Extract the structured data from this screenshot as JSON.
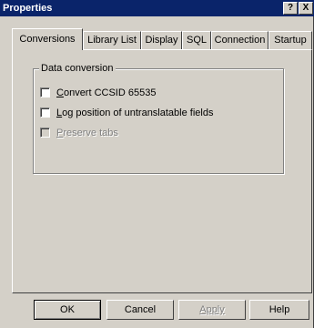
{
  "window": {
    "title": "Properties",
    "help_button": "?",
    "close_button": "X"
  },
  "tabs": [
    {
      "label": "Conversions",
      "selected": true
    },
    {
      "label": "Library List",
      "selected": false
    },
    {
      "label": "Display",
      "selected": false
    },
    {
      "label": "SQL",
      "selected": false
    },
    {
      "label": "Connection",
      "selected": false
    },
    {
      "label": "Startup",
      "selected": false
    }
  ],
  "data_conversion": {
    "group_label": "Data conversion",
    "options": [
      {
        "accel": "C",
        "rest": "onvert CCSID 65535",
        "checked": false,
        "enabled": true
      },
      {
        "accel": "L",
        "rest": "og position of untranslatable fields",
        "checked": false,
        "enabled": true
      },
      {
        "accel": "P",
        "rest": "reserve tabs",
        "checked": false,
        "enabled": false
      }
    ]
  },
  "buttons": {
    "ok": "OK",
    "cancel": "Cancel",
    "apply": "Apply",
    "help": "Help"
  },
  "colors": {
    "titlebar": "#0a246a",
    "face": "#d4d0c8",
    "disabled_text": "#808080"
  }
}
